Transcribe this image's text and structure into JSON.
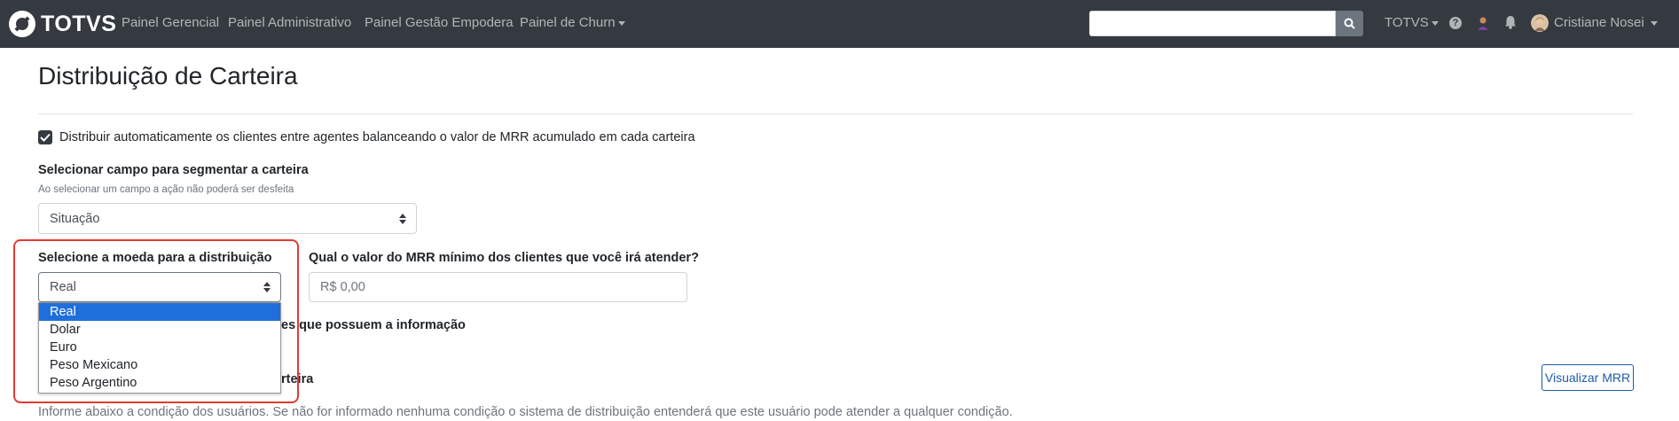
{
  "navbar": {
    "brand": "TOTVS",
    "links": [
      "Painel Gerencial",
      "Painel Administrativo",
      "Painel Gestão Empodera",
      "Painel de Churn"
    ],
    "search_value": "",
    "org_menu": "TOTVS",
    "help_icon": "?",
    "user_name": "Cristiane Nosei"
  },
  "page": {
    "title": "Distribuição de Carteira",
    "auto_distribute_label": "Distribuir automaticamente os clientes entre agentes balanceando o valor de MRR acumulado em cada carteira",
    "auto_distribute_checked": true,
    "segment_label": "Selecionar campo para segmentar a carteira",
    "segment_help": "Ao selecionar um campo a ação não poderá ser desfeita",
    "segment_value": "Situação",
    "currency_label": "Selecione a moeda para a distribuição",
    "currency_value": "Real",
    "currency_options": [
      "Real",
      "Dolar",
      "Euro",
      "Peso Mexicano",
      "Peso Argentino"
    ],
    "currency_selected_index": 0,
    "mrr_label": "Qual o valor do MRR mínimo dos clientes que você irá atender?",
    "mrr_placeholder": "R$ 0,00",
    "hidden_text_1": "es que possuem a informação",
    "hidden_text_2": "rteira",
    "view_mrr_button": "Visualizar MRR",
    "info_text": "Informe abaixo a condição dos usuários. Se não for informado nenhuma condição o sistema de distribuição entenderá que este usuário pode atender a qualquer condição."
  },
  "colors": {
    "navbar_bg": "#343a40",
    "highlight_blue": "#1e6fdc",
    "annotation_red": "#e53935"
  }
}
